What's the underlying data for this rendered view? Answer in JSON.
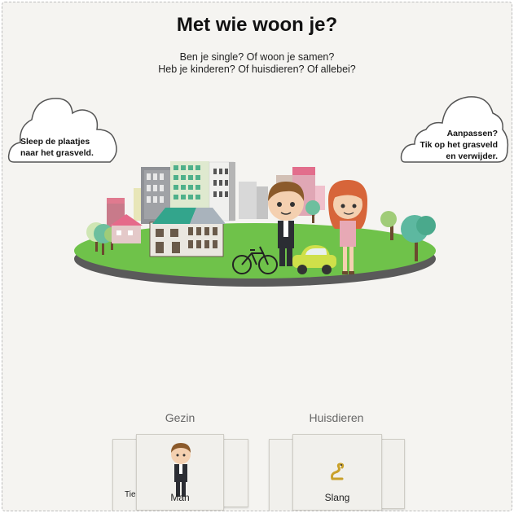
{
  "page": {
    "title": "Met wie woon je?",
    "subtitle_line1": "Ben je single? Of woon je samen?",
    "subtitle_line2": "Heb je kinderen? Of huisdieren? Of allebei?"
  },
  "hints": {
    "left": [
      "Sleep de plaatjes",
      "naar het grasveld."
    ],
    "right": [
      "Aanpassen?",
      "Tik op het grasveld",
      "en verwijder."
    ]
  },
  "categories": {
    "gezin": {
      "label": "Gezin",
      "current_card": "Man",
      "peek_left_label": "Tie",
      "current_icon": "man-figure-icon"
    },
    "huisdieren": {
      "label": "Huisdieren",
      "current_card": "Slang",
      "current_icon": "snake-icon"
    }
  },
  "colors": {
    "grass": "#6fc24a",
    "island_edge": "#5a5a5a",
    "card_bg": "#f1f0ec",
    "frame_bg": "#f5f4f1"
  },
  "scene": {
    "items": [
      "houses",
      "apartment-buildings",
      "trees",
      "bicycle",
      "car",
      "man",
      "woman"
    ]
  }
}
